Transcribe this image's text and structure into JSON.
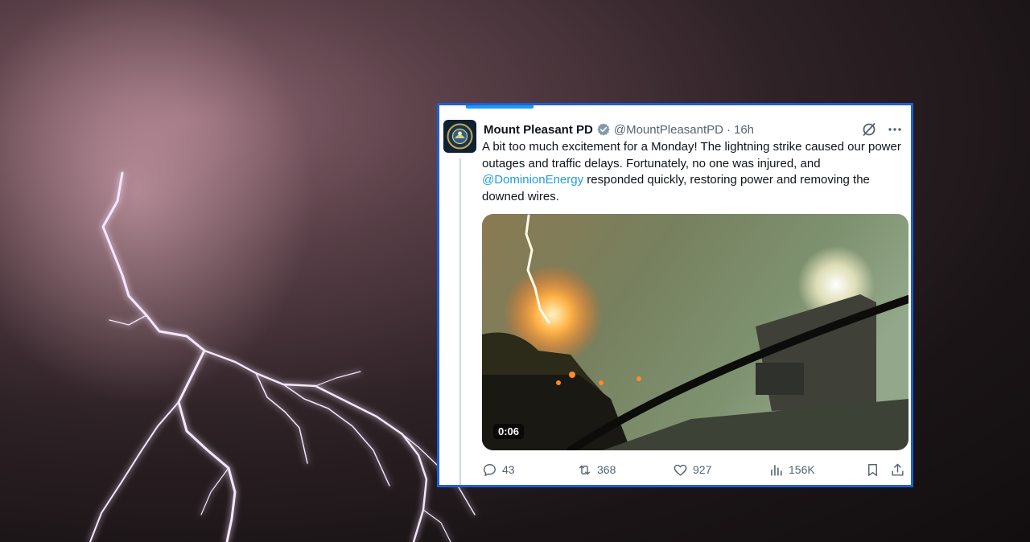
{
  "tweet": {
    "author_name": "Mount Pleasant PD",
    "verified_icon": "verified-badge-icon",
    "handle": "@MountPleasantPD",
    "separator": "·",
    "time": "16h",
    "text_part1": "A bit too much excitement for a Monday! The lightning strike caused our power outages and traffic delays. Fortunately, no one was injured, and",
    "mention": "@DominionEnergy",
    "text_part2": " responded quickly, restoring power and removing the downed wires.",
    "video_duration": "0:06",
    "replies": "43",
    "reposts": "368",
    "likes": "927",
    "views": "156K"
  },
  "colors": {
    "accent": "#1d9bf0",
    "frame_border": "#1f5fd6",
    "muted_text": "#536471",
    "primary_text": "#0f1419"
  }
}
